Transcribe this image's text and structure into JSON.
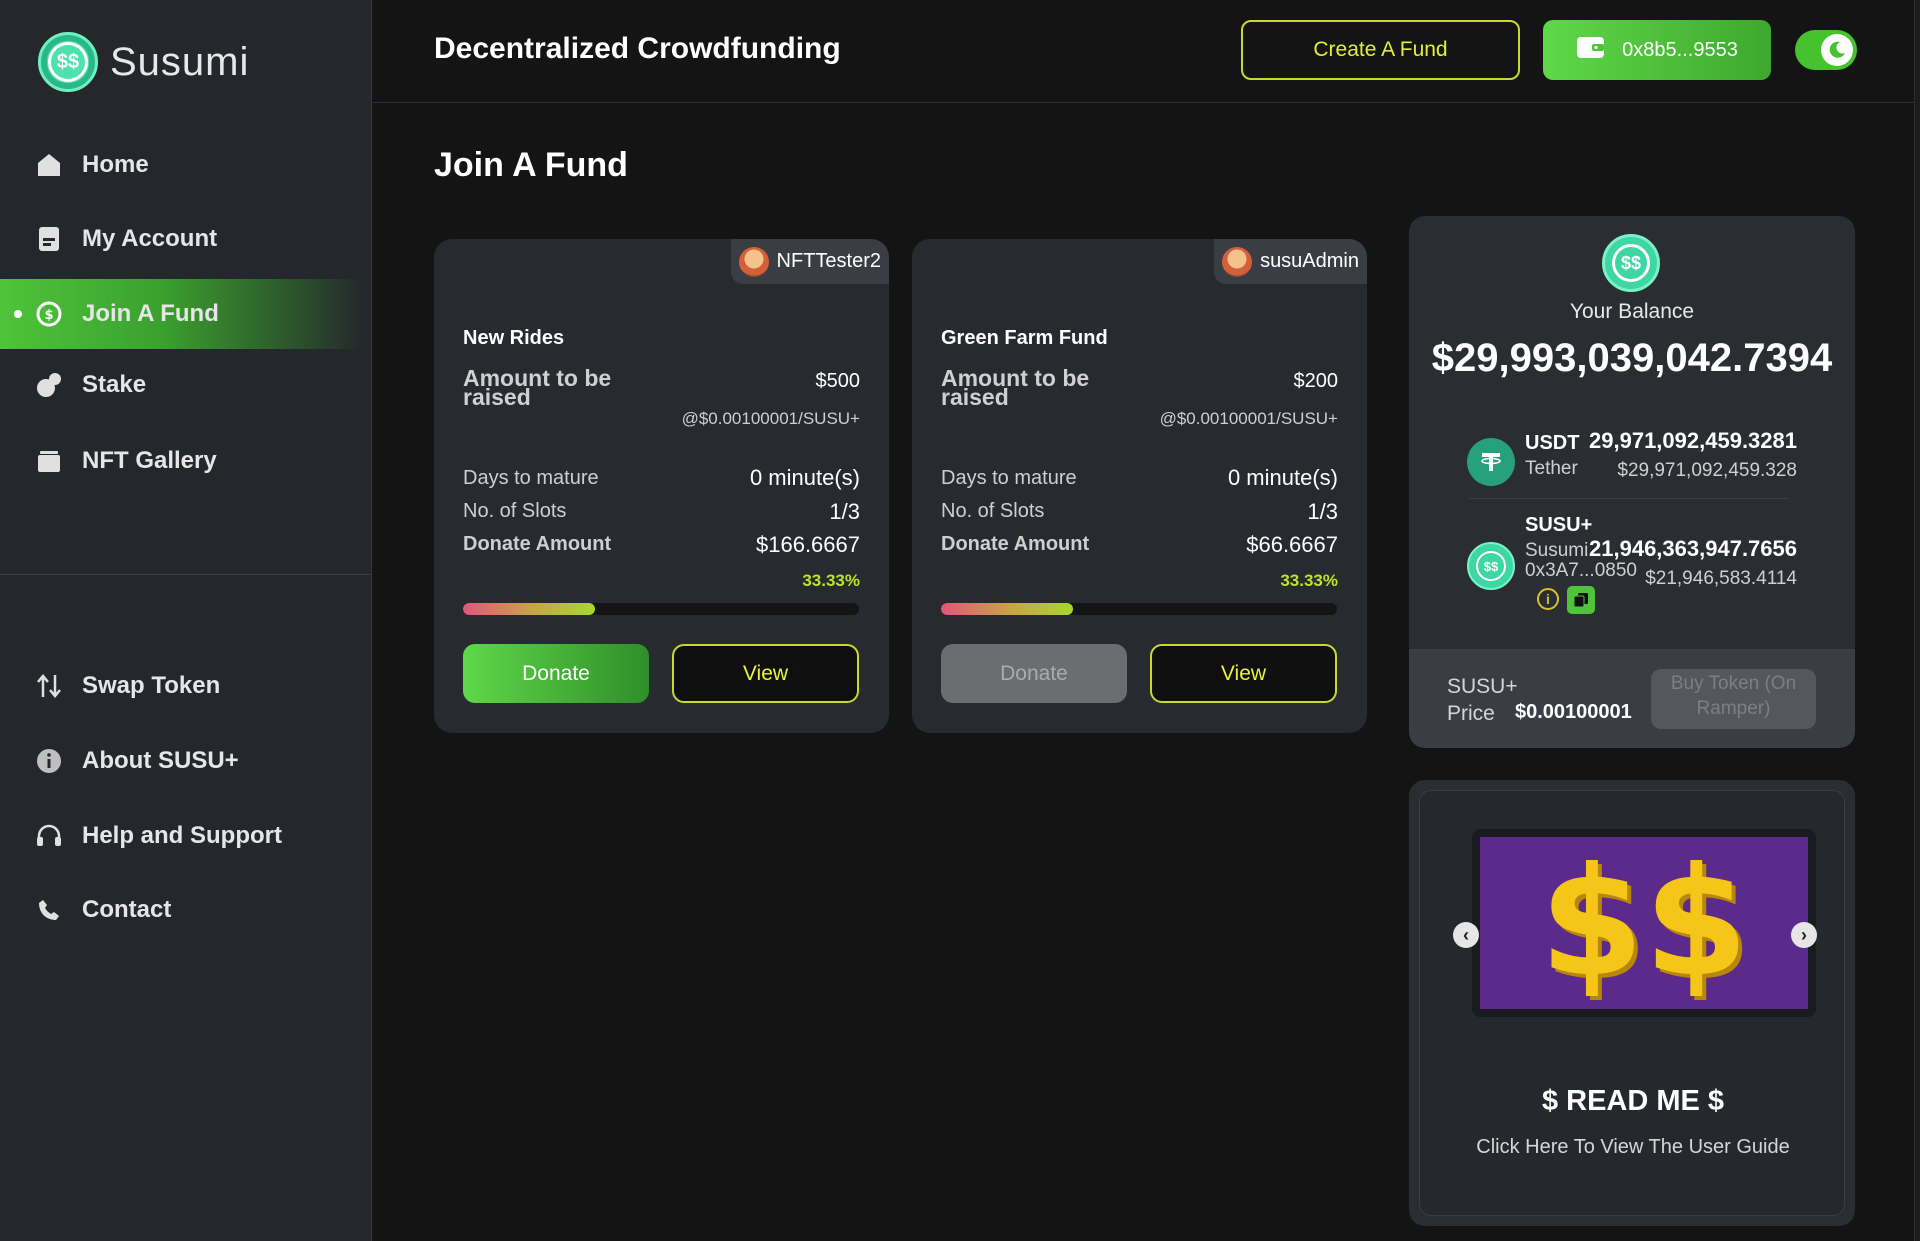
{
  "brand": {
    "name": "Susumi",
    "logo_glyph": "$$"
  },
  "sidebar": {
    "items": [
      {
        "label": "Home",
        "icon": "home-icon"
      },
      {
        "label": "My Account",
        "icon": "account-icon"
      },
      {
        "label": "Join A Fund",
        "icon": "fund-icon",
        "active": true
      },
      {
        "label": "Stake",
        "icon": "stake-icon"
      },
      {
        "label": "NFT Gallery",
        "icon": "gallery-icon"
      },
      {
        "label": "Swap Token",
        "icon": "swap-icon"
      },
      {
        "label": "About SUSU+",
        "icon": "info-icon"
      },
      {
        "label": "Help and Support",
        "icon": "headset-icon"
      },
      {
        "label": "Contact",
        "icon": "phone-icon"
      }
    ]
  },
  "header": {
    "title": "Decentralized Crowdfunding",
    "create_label": "Create A Fund",
    "wallet_label": "0x8b5...9553"
  },
  "main": {
    "title": "Join A Fund"
  },
  "funds": [
    {
      "owner": "NFTTester2",
      "name": "New Rides",
      "amount_label": "Amount to be raised",
      "amount": "$500",
      "rate": "@$0.00100001/SUSU+",
      "days_label": "Days to mature",
      "days": "0 minute(s)",
      "slots_label": "No. of Slots",
      "slots": "1/3",
      "donate_label": "Donate Amount",
      "donate_amount": "$166.6667",
      "percent": "33.33%",
      "progress": 0.3333,
      "donate_btn": "Donate",
      "donate_enabled": true,
      "view_btn": "View"
    },
    {
      "owner": "susuAdmin",
      "name": "Green Farm Fund",
      "amount_label": "Amount to be raised",
      "amount": "$200",
      "rate": "@$0.00100001/SUSU+",
      "days_label": "Days to mature",
      "days": "0 minute(s)",
      "slots_label": "No. of Slots",
      "slots": "1/3",
      "donate_label": "Donate Amount",
      "donate_amount": "$66.6667",
      "percent": "33.33%",
      "progress": 0.3333,
      "donate_btn": "Donate",
      "donate_enabled": false,
      "view_btn": "View"
    }
  ],
  "balance": {
    "label": "Your Balance",
    "amount": "$29,993,039,042.7394",
    "tokens": [
      {
        "symbol": "USDT",
        "name": "Tether",
        "balance": "29,971,092,459.3281",
        "usd": "$29,971,092,459.328",
        "color": "#26a17b"
      },
      {
        "symbol": "SUSU+",
        "name": "Susumi",
        "address": "0x3A7...0850",
        "balance": "21,946,363,947.7656",
        "usd": "$21,946,583.4114",
        "color": "#3ed6a3"
      }
    ],
    "price_label_1": "SUSU+",
    "price_label_2": "Price",
    "price_value": "$0.00100001",
    "buy_label": "Buy Token (On Ramper)"
  },
  "readme": {
    "title": "$ READ ME $",
    "subtitle": "Click Here To View The User Guide",
    "image_glyph": "$$"
  },
  "colors": {
    "accent": "#4fc43a",
    "yellow": "#c9d92e",
    "bg": "#141414",
    "panel": "#272a2f"
  }
}
